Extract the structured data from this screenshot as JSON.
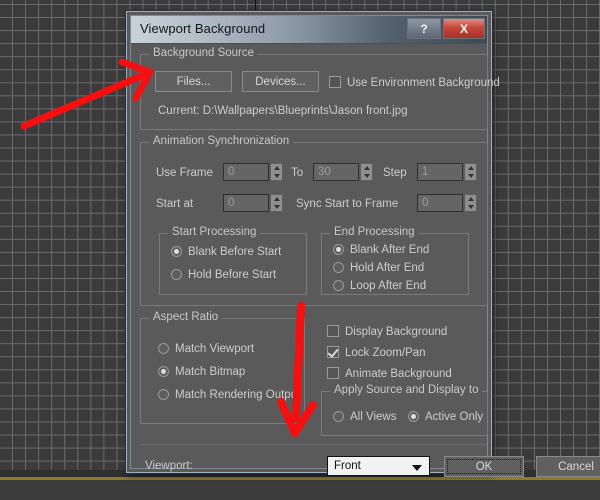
{
  "app": {
    "viewport_label": "3ds Max viewport grid"
  },
  "dialog": {
    "title": "Viewport Background",
    "titlebar": {
      "help_label": "?",
      "close_label": "X",
      "help_icon": "question-mark-icon",
      "close_icon": "close-x-icon"
    },
    "background_source": {
      "legend": "Background Source",
      "files_button": "Files...",
      "devices_button": "Devices...",
      "use_environment_background": {
        "label": "Use Environment Background",
        "checked": false
      },
      "current_label": "Current: D:\\Wallpapers\\Blueprints\\Jason front.jpg"
    },
    "animation_sync": {
      "legend": "Animation Synchronization",
      "use_frame_label": "Use Frame",
      "use_frame_value": "0",
      "to_label": "To",
      "to_value": "30",
      "step_label": "Step",
      "step_value": "1",
      "start_at_label": "Start at",
      "start_at_value": "0",
      "sync_start_label": "Sync Start to Frame",
      "sync_start_value": "0",
      "start_processing": {
        "legend": "Start Processing",
        "options": [
          {
            "label": "Blank Before Start",
            "selected": true
          },
          {
            "label": "Hold Before Start",
            "selected": false
          }
        ]
      },
      "end_processing": {
        "legend": "End Processing",
        "options": [
          {
            "label": "Blank After End",
            "selected": true
          },
          {
            "label": "Hold After End",
            "selected": false
          },
          {
            "label": "Loop After End",
            "selected": false
          }
        ]
      }
    },
    "aspect_ratio": {
      "legend": "Aspect Ratio",
      "options": [
        {
          "label": "Match Viewport",
          "selected": false
        },
        {
          "label": "Match Bitmap",
          "selected": true
        },
        {
          "label": "Match Rendering Output",
          "selected": false
        }
      ]
    },
    "display_options": [
      {
        "label": "Display Background",
        "checked": false
      },
      {
        "label": "Lock Zoom/Pan",
        "checked": true
      },
      {
        "label": "Animate Background",
        "checked": false
      }
    ],
    "apply_source": {
      "legend": "Apply Source and Display to",
      "options": [
        {
          "label": "All Views",
          "selected": false
        },
        {
          "label": "Active Only",
          "selected": true
        }
      ]
    },
    "footer": {
      "viewport_label": "Viewport:",
      "viewport_value": "Front",
      "ok_label": "OK",
      "cancel_label": "Cancel"
    }
  },
  "annotations": {
    "arrow_color": "#f41010",
    "arrow_to_files": "arrow-pointing-to-files-button",
    "arrow_to_viewport": "arrow-pointing-to-viewport-dropdown"
  }
}
